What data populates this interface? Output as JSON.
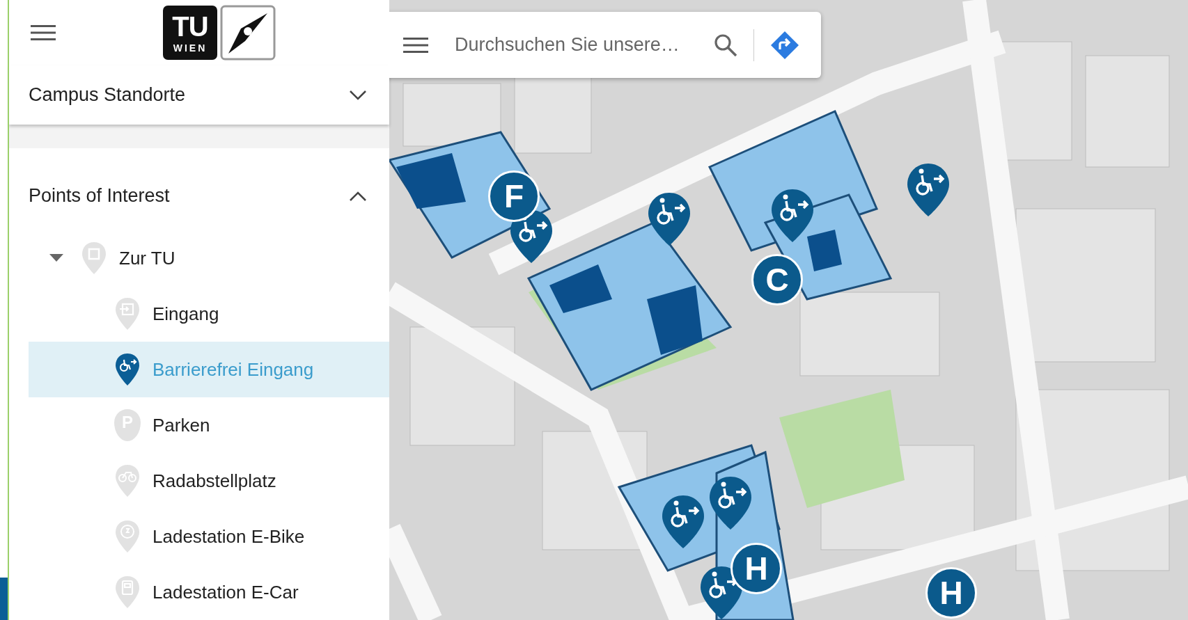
{
  "logo": {
    "top": "TU",
    "bottom": "WIEN"
  },
  "sections": [
    {
      "title": "Campus Standorte",
      "expanded": false
    },
    {
      "title": "Points of Interest",
      "expanded": true
    }
  ],
  "poi_tree": [
    {
      "label": "Zur TU",
      "kind": "entrance",
      "expanded": true,
      "selected": false,
      "children": [
        {
          "label": "Eingang",
          "kind": "entrance",
          "selected": false
        },
        {
          "label": "Barrierefrei Eingang",
          "kind": "accessible",
          "selected": true
        },
        {
          "label": "Parken",
          "kind": "parking",
          "icon_text": "P",
          "selected": false
        },
        {
          "label": "Radabstellplatz",
          "kind": "bike",
          "selected": false
        },
        {
          "label": "Ladestation E-Bike",
          "kind": "ebike",
          "selected": false
        },
        {
          "label": "Ladestation E-Car",
          "kind": "ecar",
          "selected": false
        }
      ]
    }
  ],
  "search": {
    "placeholder": "Durchsuchen Sie unsere…"
  },
  "map_markers": [
    {
      "kind": "building",
      "label": "F"
    },
    {
      "kind": "accessible"
    },
    {
      "kind": "accessible"
    },
    {
      "kind": "accessible"
    },
    {
      "kind": "accessible"
    },
    {
      "kind": "building",
      "label": "C"
    },
    {
      "kind": "accessible"
    },
    {
      "kind": "accessible"
    },
    {
      "kind": "accessible"
    },
    {
      "kind": "building",
      "label": "H"
    },
    {
      "kind": "building",
      "label": "H"
    }
  ]
}
